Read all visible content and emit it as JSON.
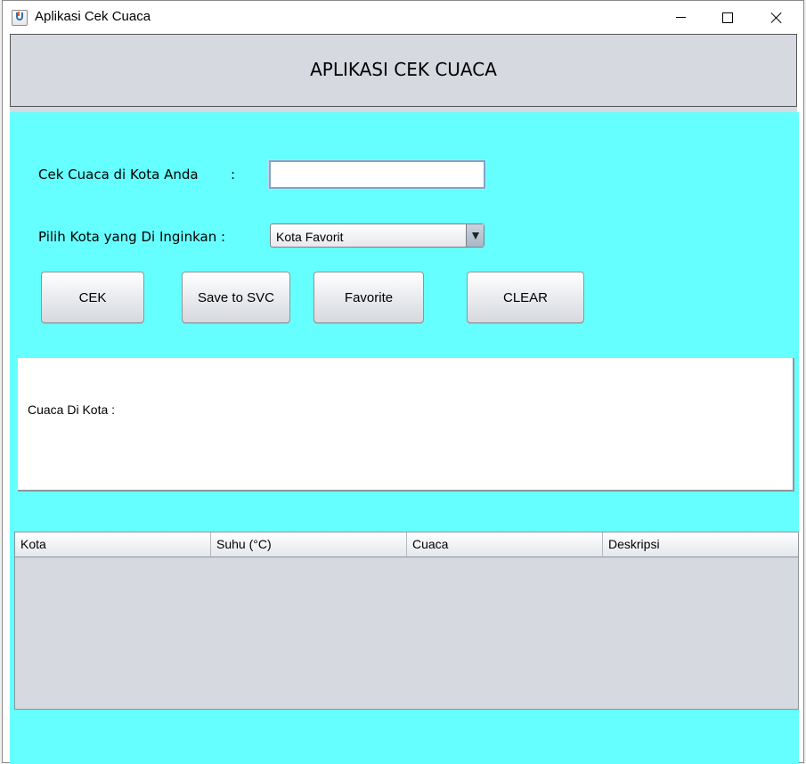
{
  "window": {
    "title": "Aplikasi Cek Cuaca"
  },
  "header": {
    "title": "APLIKASI CEK CUACA"
  },
  "form": {
    "city_label": "Cek Cuaca di Kota Anda",
    "city_colon": ":",
    "city_input_value": "",
    "choose_label": "Pilih Kota yang Di Inginkan :",
    "choose_selected": "Kota Favorit"
  },
  "buttons": {
    "cek": "CEK",
    "save": "Save to SVC",
    "favorite": "Favorite",
    "clear": "CLEAR"
  },
  "result": {
    "label": "Cuaca Di Kota :"
  },
  "table": {
    "columns": [
      "Kota",
      "Suhu (°C)",
      "Cuaca",
      "Deskripsi"
    ],
    "rows": []
  },
  "colors": {
    "content_bg": "#66ffff",
    "panel_gray": "#d6d9df"
  }
}
